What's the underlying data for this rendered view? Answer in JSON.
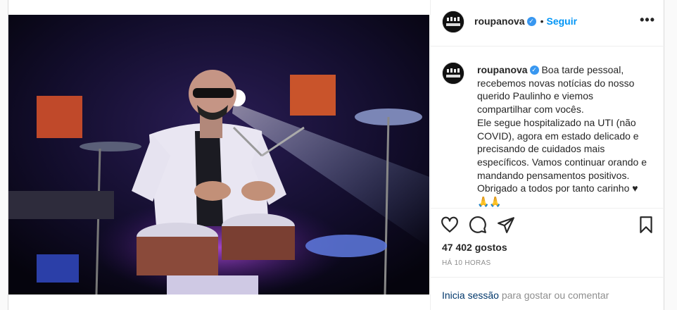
{
  "post": {
    "username": "roupanova",
    "verified_mark": "✓",
    "follow_separator": "•",
    "follow_label": "Seguir",
    "more_label": "•••",
    "caption": {
      "username": "roupanova",
      "lines": [
        "Boa tarde pessoal,",
        "recebemos novas notícias do nosso",
        "querido Paulinho e viemos",
        "compartilhar com vocês.",
        "Ele segue hospitalizado na UTI (não",
        "COVID), agora em estado delicado e",
        "precisando de cuidados mais",
        "específicos. Vamos continuar orando e",
        "mandando pensamentos positivos.",
        "Obrigado a todos por tanto carinho ♥",
        "🙏🙏"
      ]
    },
    "likes": "47 402 gostos",
    "time": "HÁ 10 HORAS",
    "login_link": "Inicia sessão",
    "login_rest": " para gostar ou comentar",
    "icons": {
      "like": "heart-icon",
      "comment": "comment-icon",
      "share": "paper-plane-icon",
      "save": "bookmark-icon"
    },
    "colors": {
      "link_blue": "#0095f6",
      "verified_blue": "#3897f0",
      "login_blue": "#00376b",
      "muted": "#8e8e8e"
    }
  }
}
